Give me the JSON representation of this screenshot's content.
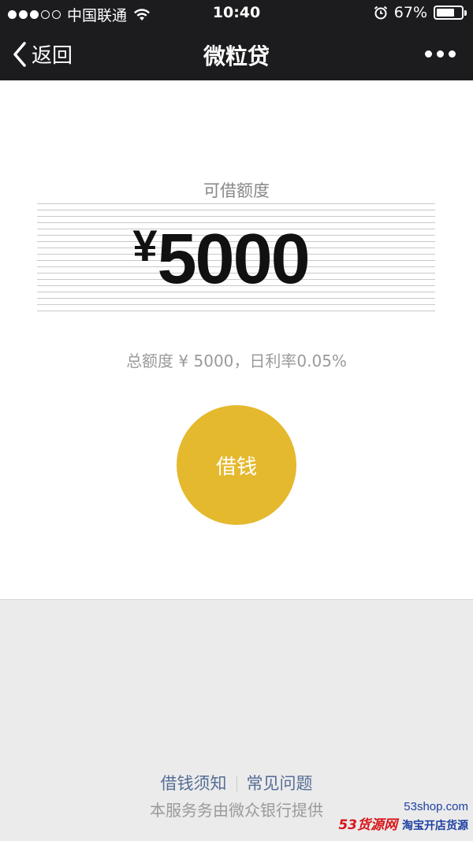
{
  "status_bar": {
    "carrier": "中国联通",
    "time": "10:40",
    "battery": "67%",
    "signal_bars_filled": 3,
    "signal_bars_total": 5
  },
  "nav": {
    "back_label": "返回",
    "title": "微粒贷"
  },
  "loan": {
    "limit_label": "可借额度",
    "currency_symbol": "¥",
    "amount": "5000",
    "total_info": "总额度 ¥ 5000，日利率0.05%",
    "borrow_button": "借钱"
  },
  "footer": {
    "link_notice": "借钱须知",
    "link_faq": "常见问题",
    "provider": "本服务务由微众银行提供"
  },
  "watermark": {
    "site": "53shop.com",
    "brand": "53货源网",
    "slogan": "淘宝开店货源"
  },
  "colors": {
    "bar_bg": "#1c1c1f",
    "accent": "#e5b92e",
    "link": "#566e96",
    "page_bg": "#ebebeb"
  }
}
